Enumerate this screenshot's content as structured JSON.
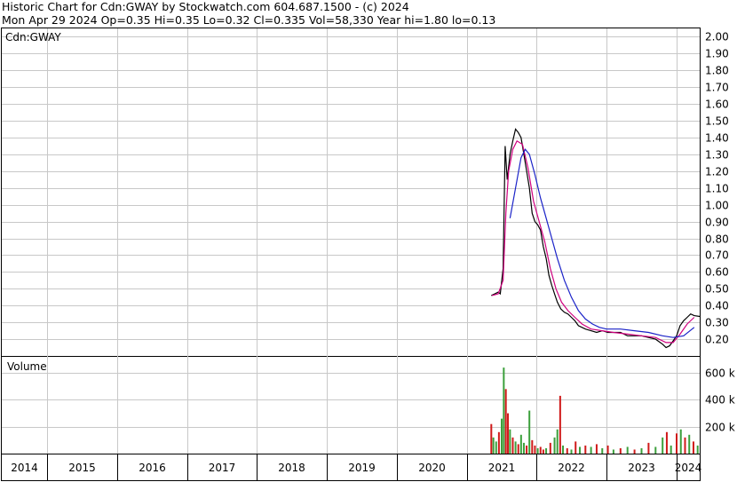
{
  "header": {
    "line1": "Historic Chart for Cdn:GWAY by Stockwatch.com 604.687.1500 - (c) 2024",
    "line2": "Mon Apr 29 2024  Op=0.35  Hi=0.35  Lo=0.32  Cl=0.335  Vol=58,330  Year hi=1.80  lo=0.13"
  },
  "colors": {
    "grid": "#c8c8c8",
    "price": "#000000",
    "ma_short": "#d0007f",
    "ma_long": "#1a22c8",
    "vol_up": "#3ca03c",
    "vol_down": "#d01a1a"
  },
  "chart_data": [
    {
      "type": "line",
      "label": "Cdn:GWAY",
      "x_unit": "year",
      "ylim": [
        0.1,
        2.05
      ],
      "y_ticks": [
        "2.00",
        "1.90",
        "1.80",
        "1.70",
        "1.60",
        "1.50",
        "1.40",
        "1.30",
        "1.20",
        "1.10",
        "1.00",
        "0.90",
        "0.80",
        "0.70",
        "0.60",
        "0.50",
        "0.40",
        "0.30",
        "0.20"
      ],
      "x_ticks": [
        "2014",
        "2015",
        "2016",
        "2017",
        "2018",
        "2019",
        "2020",
        "2021",
        "2022",
        "2023",
        "2024"
      ],
      "series": [
        {
          "role": "price",
          "points": [
            [
              2021.35,
              0.46
            ],
            [
              2021.4,
              0.47
            ],
            [
              2021.45,
              0.48
            ],
            [
              2021.48,
              0.47
            ],
            [
              2021.52,
              0.62
            ],
            [
              2021.55,
              1.35
            ],
            [
              2021.58,
              1.15
            ],
            [
              2021.62,
              1.3
            ],
            [
              2021.66,
              1.38
            ],
            [
              2021.7,
              1.45
            ],
            [
              2021.74,
              1.43
            ],
            [
              2021.78,
              1.4
            ],
            [
              2021.82,
              1.3
            ],
            [
              2021.86,
              1.2
            ],
            [
              2021.9,
              1.1
            ],
            [
              2021.94,
              0.95
            ],
            [
              2021.98,
              0.9
            ],
            [
              2022.02,
              0.88
            ],
            [
              2022.06,
              0.85
            ],
            [
              2022.1,
              0.75
            ],
            [
              2022.14,
              0.68
            ],
            [
              2022.18,
              0.58
            ],
            [
              2022.22,
              0.52
            ],
            [
              2022.26,
              0.47
            ],
            [
              2022.3,
              0.42
            ],
            [
              2022.35,
              0.38
            ],
            [
              2022.4,
              0.36
            ],
            [
              2022.45,
              0.35
            ],
            [
              2022.5,
              0.33
            ],
            [
              2022.55,
              0.31
            ],
            [
              2022.6,
              0.28
            ],
            [
              2022.65,
              0.27
            ],
            [
              2022.7,
              0.26
            ],
            [
              2022.78,
              0.25
            ],
            [
              2022.86,
              0.24
            ],
            [
              2022.94,
              0.25
            ],
            [
              2023.02,
              0.24
            ],
            [
              2023.1,
              0.24
            ],
            [
              2023.2,
              0.24
            ],
            [
              2023.3,
              0.22
            ],
            [
              2023.4,
              0.22
            ],
            [
              2023.5,
              0.22
            ],
            [
              2023.6,
              0.21
            ],
            [
              2023.7,
              0.2
            ],
            [
              2023.8,
              0.17
            ],
            [
              2023.85,
              0.15
            ],
            [
              2023.9,
              0.16
            ],
            [
              2023.95,
              0.19
            ],
            [
              2024.0,
              0.22
            ],
            [
              2024.05,
              0.28
            ],
            [
              2024.1,
              0.31
            ],
            [
              2024.15,
              0.33
            ],
            [
              2024.2,
              0.35
            ],
            [
              2024.25,
              0.34
            ],
            [
              2024.33,
              0.335
            ]
          ]
        },
        {
          "role": "short moving average",
          "points": [
            [
              2021.36,
              0.46
            ],
            [
              2021.45,
              0.47
            ],
            [
              2021.52,
              0.55
            ],
            [
              2021.56,
              0.95
            ],
            [
              2021.6,
              1.2
            ],
            [
              2021.66,
              1.33
            ],
            [
              2021.72,
              1.38
            ],
            [
              2021.8,
              1.36
            ],
            [
              2021.88,
              1.22
            ],
            [
              2021.96,
              1.02
            ],
            [
              2022.04,
              0.9
            ],
            [
              2022.12,
              0.78
            ],
            [
              2022.2,
              0.62
            ],
            [
              2022.28,
              0.5
            ],
            [
              2022.36,
              0.42
            ],
            [
              2022.45,
              0.37
            ],
            [
              2022.55,
              0.33
            ],
            [
              2022.65,
              0.29
            ],
            [
              2022.78,
              0.26
            ],
            [
              2022.94,
              0.25
            ],
            [
              2023.1,
              0.24
            ],
            [
              2023.3,
              0.23
            ],
            [
              2023.5,
              0.22
            ],
            [
              2023.7,
              0.21
            ],
            [
              2023.85,
              0.18
            ],
            [
              2023.95,
              0.18
            ],
            [
              2024.05,
              0.23
            ],
            [
              2024.15,
              0.29
            ],
            [
              2024.25,
              0.33
            ]
          ]
        },
        {
          "role": "long moving average",
          "points": [
            [
              2021.62,
              0.92
            ],
            [
              2021.7,
              1.1
            ],
            [
              2021.78,
              1.28
            ],
            [
              2021.84,
              1.33
            ],
            [
              2021.9,
              1.3
            ],
            [
              2021.98,
              1.18
            ],
            [
              2022.06,
              1.04
            ],
            [
              2022.14,
              0.92
            ],
            [
              2022.22,
              0.8
            ],
            [
              2022.3,
              0.68
            ],
            [
              2022.4,
              0.55
            ],
            [
              2022.5,
              0.45
            ],
            [
              2022.6,
              0.37
            ],
            [
              2022.7,
              0.32
            ],
            [
              2022.8,
              0.29
            ],
            [
              2022.9,
              0.27
            ],
            [
              2023.0,
              0.26
            ],
            [
              2023.2,
              0.26
            ],
            [
              2023.4,
              0.25
            ],
            [
              2023.6,
              0.24
            ],
            [
              2023.8,
              0.22
            ],
            [
              2023.95,
              0.21
            ],
            [
              2024.1,
              0.22
            ],
            [
              2024.25,
              0.27
            ]
          ]
        }
      ]
    },
    {
      "type": "bar",
      "label": "Volume",
      "ylim": [
        0,
        720000
      ],
      "y_ticks": [
        "600 k",
        "400 k",
        "200 k"
      ],
      "y_tick_values": [
        600000,
        400000,
        200000
      ],
      "bars": [
        [
          2021.35,
          220000,
          "down"
        ],
        [
          2021.38,
          120000,
          "up"
        ],
        [
          2021.42,
          90000,
          "up"
        ],
        [
          2021.46,
          160000,
          "down"
        ],
        [
          2021.5,
          260000,
          "up"
        ],
        [
          2021.53,
          640000,
          "up"
        ],
        [
          2021.56,
          480000,
          "down"
        ],
        [
          2021.59,
          300000,
          "down"
        ],
        [
          2021.62,
          180000,
          "up"
        ],
        [
          2021.66,
          120000,
          "down"
        ],
        [
          2021.7,
          90000,
          "up"
        ],
        [
          2021.74,
          70000,
          "down"
        ],
        [
          2021.78,
          140000,
          "up"
        ],
        [
          2021.82,
          80000,
          "up"
        ],
        [
          2021.86,
          60000,
          "down"
        ],
        [
          2021.9,
          320000,
          "up"
        ],
        [
          2021.94,
          100000,
          "down"
        ],
        [
          2021.98,
          60000,
          "down"
        ],
        [
          2022.02,
          40000,
          "up"
        ],
        [
          2022.06,
          50000,
          "down"
        ],
        [
          2022.1,
          30000,
          "down"
        ],
        [
          2022.14,
          40000,
          "up"
        ],
        [
          2022.2,
          80000,
          "down"
        ],
        [
          2022.26,
          120000,
          "up"
        ],
        [
          2022.3,
          180000,
          "up"
        ],
        [
          2022.34,
          430000,
          "down"
        ],
        [
          2022.38,
          60000,
          "up"
        ],
        [
          2022.44,
          40000,
          "down"
        ],
        [
          2022.5,
          30000,
          "up"
        ],
        [
          2022.56,
          90000,
          "down"
        ],
        [
          2022.62,
          50000,
          "up"
        ],
        [
          2022.7,
          60000,
          "down"
        ],
        [
          2022.78,
          50000,
          "up"
        ],
        [
          2022.86,
          70000,
          "down"
        ],
        [
          2022.94,
          40000,
          "up"
        ],
        [
          2023.02,
          60000,
          "down"
        ],
        [
          2023.1,
          30000,
          "up"
        ],
        [
          2023.2,
          40000,
          "down"
        ],
        [
          2023.3,
          50000,
          "up"
        ],
        [
          2023.4,
          30000,
          "down"
        ],
        [
          2023.5,
          40000,
          "up"
        ],
        [
          2023.6,
          80000,
          "down"
        ],
        [
          2023.7,
          50000,
          "up"
        ],
        [
          2023.8,
          120000,
          "up"
        ],
        [
          2023.86,
          160000,
          "down"
        ],
        [
          2023.92,
          60000,
          "up"
        ],
        [
          2024.0,
          150000,
          "down"
        ],
        [
          2024.06,
          180000,
          "up"
        ],
        [
          2024.12,
          120000,
          "down"
        ],
        [
          2024.18,
          140000,
          "up"
        ],
        [
          2024.24,
          90000,
          "down"
        ],
        [
          2024.3,
          60000,
          "up"
        ]
      ]
    }
  ]
}
